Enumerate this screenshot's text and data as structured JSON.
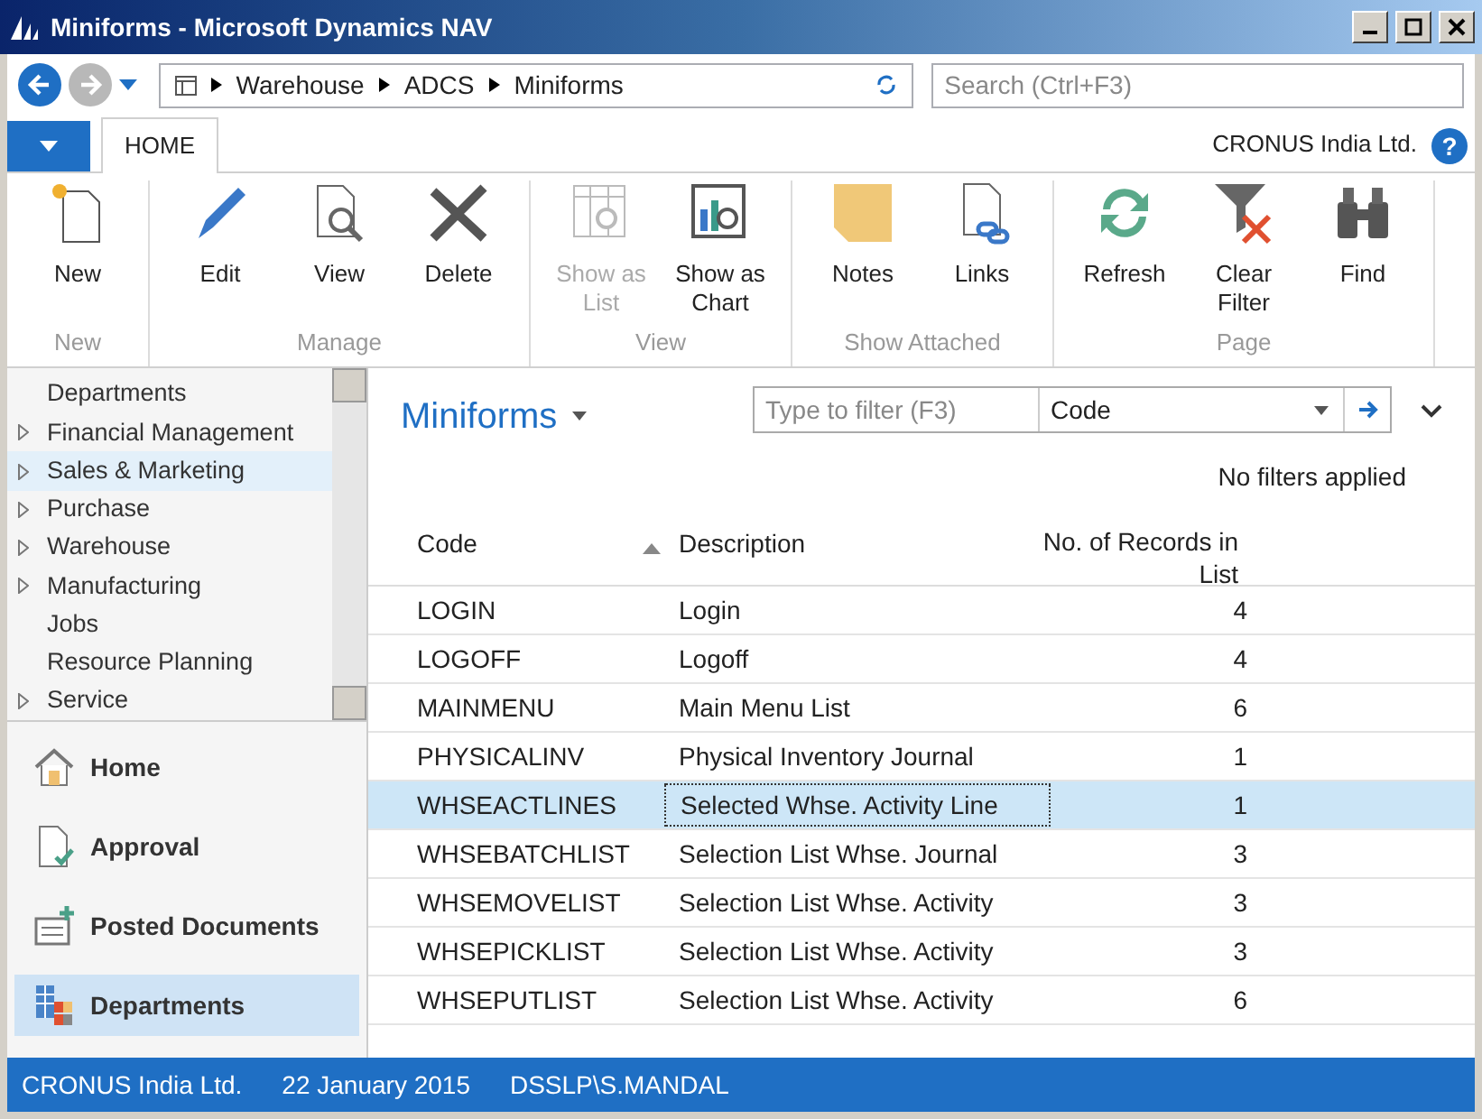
{
  "window": {
    "title": "Miniforms - Microsoft Dynamics NAV"
  },
  "address_bar": {
    "breadcrumb": [
      "Warehouse",
      "ADCS",
      "Miniforms"
    ]
  },
  "search": {
    "placeholder": "Search (Ctrl+F3)"
  },
  "tabs": [
    {
      "label": "HOME",
      "selected": true
    }
  ],
  "company": "CRONUS India Ltd.",
  "help_button": "?",
  "ribbon_groups": [
    {
      "label": "New",
      "actions": [
        {
          "label": "New",
          "kind": "new",
          "disabled": false
        }
      ]
    },
    {
      "label": "Manage",
      "actions": [
        {
          "label": "Edit",
          "kind": "edit",
          "disabled": false
        },
        {
          "label": "View",
          "kind": "view",
          "disabled": false
        },
        {
          "label": "Delete",
          "kind": "delete",
          "disabled": false
        }
      ]
    },
    {
      "label": "View",
      "actions": [
        {
          "label": "Show as List",
          "kind": "list",
          "disabled": true
        },
        {
          "label": "Show as Chart",
          "kind": "chart",
          "disabled": false
        }
      ]
    },
    {
      "label": "Show Attached",
      "actions": [
        {
          "label": "Notes",
          "kind": "notes",
          "disabled": false
        },
        {
          "label": "Links",
          "kind": "links",
          "disabled": false
        }
      ]
    },
    {
      "label": "Page",
      "actions": [
        {
          "label": "Refresh",
          "kind": "refresh",
          "disabled": false
        },
        {
          "label": "Clear Filter",
          "kind": "clearfilter",
          "disabled": false
        },
        {
          "label": "Find",
          "kind": "find",
          "disabled": false
        }
      ]
    }
  ],
  "nav_tree": [
    {
      "label": "Departments",
      "expandable": false,
      "selected": false
    },
    {
      "label": "Financial Management",
      "expandable": true,
      "selected": false
    },
    {
      "label": "Sales & Marketing",
      "expandable": true,
      "selected": true
    },
    {
      "label": "Purchase",
      "expandable": true,
      "selected": false
    },
    {
      "label": "Warehouse",
      "expandable": true,
      "selected": false
    },
    {
      "label": "Manufacturing",
      "expandable": true,
      "selected": false
    },
    {
      "label": "Jobs",
      "expandable": false,
      "selected": false
    },
    {
      "label": "Resource Planning",
      "expandable": false,
      "selected": false
    },
    {
      "label": "Service",
      "expandable": true,
      "selected": false
    }
  ],
  "nav_buttons": [
    {
      "label": "Home",
      "kind": "home",
      "selected": false
    },
    {
      "label": "Approval",
      "kind": "approval",
      "selected": false
    },
    {
      "label": "Posted Documents",
      "kind": "posted",
      "selected": false
    },
    {
      "label": "Departments",
      "kind": "departments",
      "selected": true
    }
  ],
  "page": {
    "title": "Miniforms",
    "filter_placeholder": "Type to filter (F3)",
    "filter_field": "Code",
    "filter_status": "No filters applied"
  },
  "table": {
    "columns": [
      "Code",
      "Description",
      "No. of Records in List"
    ],
    "rows": [
      {
        "cells": [
          "LOGIN",
          "Login",
          "4"
        ],
        "selected": false
      },
      {
        "cells": [
          "LOGOFF",
          "Logoff",
          "4"
        ],
        "selected": false
      },
      {
        "cells": [
          "MAINMENU",
          "Main Menu List",
          "6"
        ],
        "selected": false
      },
      {
        "cells": [
          "PHYSICALINV",
          "Physical Inventory Journal",
          "1"
        ],
        "selected": false
      },
      {
        "cells": [
          "WHSEACTLINES",
          "Selected Whse. Activity Line",
          "1"
        ],
        "selected": true
      },
      {
        "cells": [
          "WHSEBATCHLIST",
          "Selection List Whse. Journal",
          "3"
        ],
        "selected": false
      },
      {
        "cells": [
          "WHSEMOVELIST",
          "Selection List Whse. Activity",
          "3"
        ],
        "selected": false
      },
      {
        "cells": [
          "WHSEPICKLIST",
          "Selection List Whse. Activity",
          "3"
        ],
        "selected": false
      },
      {
        "cells": [
          "WHSEPUTLIST",
          "Selection List Whse. Activity",
          "6"
        ],
        "selected": false
      }
    ]
  },
  "status_bar": [
    "CRONUS India Ltd.",
    "22 January 2015",
    "DSSLP\\S.MANDAL"
  ]
}
